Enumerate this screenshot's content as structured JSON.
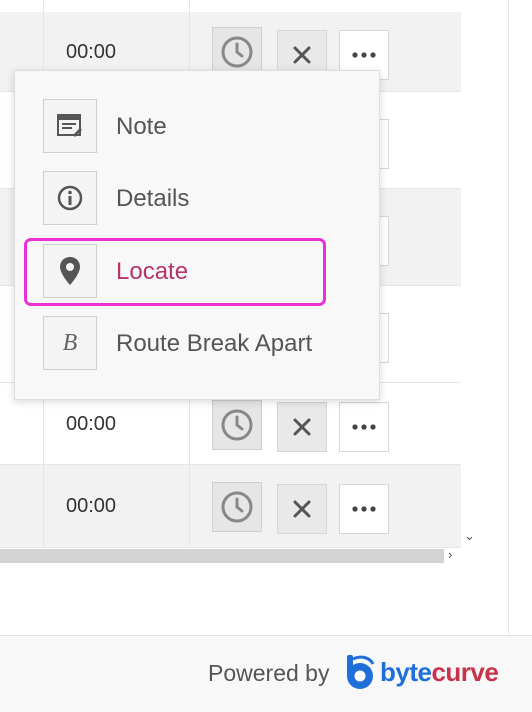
{
  "table": {
    "rows": [
      {
        "time": "00:00"
      },
      {
        "time": ""
      },
      {
        "time": ""
      },
      {
        "time": ""
      },
      {
        "time": "00:00"
      },
      {
        "time": "00:00"
      }
    ]
  },
  "context_menu": {
    "items": [
      {
        "label": "Note",
        "icon": "note-icon"
      },
      {
        "label": "Details",
        "icon": "info-icon"
      },
      {
        "label": "Locate",
        "icon": "map-pin-icon",
        "highlighted": true
      },
      {
        "label": "Route Break Apart",
        "icon": "italic-b-icon",
        "icon_glyph": "B"
      }
    ]
  },
  "scrollbar": {
    "down_arrow": "⌄",
    "right_arrow": "›"
  },
  "footer": {
    "powered_by": "Powered by",
    "brand_prefix": "byte",
    "brand_suffix": "curve"
  },
  "colors": {
    "highlight": "#e830d6",
    "active_text": "#b8336a",
    "brand_blue": "#1e6fd9",
    "brand_red": "#c8334b"
  }
}
